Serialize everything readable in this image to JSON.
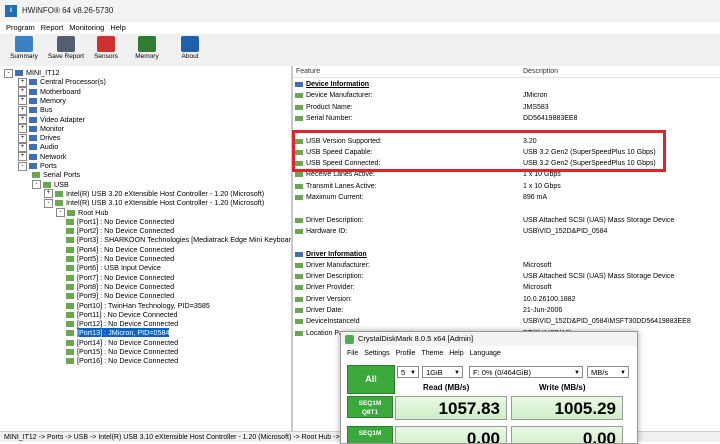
{
  "window": {
    "title": "HWiNFO® 64 v8.26-5730"
  },
  "menu": [
    "Program",
    "Report",
    "Monitoring",
    "Help"
  ],
  "toolbar": [
    {
      "label": "Summary",
      "icon": "summary-icon",
      "color": "#3b82c4"
    },
    {
      "label": "Save Report",
      "icon": "save-icon",
      "color": "#555e6e"
    },
    {
      "label": "Sensors",
      "icon": "thermometer-icon",
      "color": "#d03030"
    },
    {
      "label": "Memory",
      "icon": "memory-icon",
      "color": "#2e7d32"
    },
    {
      "label": "About",
      "icon": "info-icon",
      "color": "#1f5fb0"
    }
  ],
  "tree": [
    {
      "text": "MINI_IT12",
      "level": 0,
      "exp": "-"
    },
    {
      "text": "Central Processor(s)",
      "level": 1,
      "exp": "+"
    },
    {
      "text": "Motherboard",
      "level": 1,
      "exp": "+"
    },
    {
      "text": "Memory",
      "level": 1,
      "exp": "+"
    },
    {
      "text": "Bus",
      "level": 1,
      "exp": "+"
    },
    {
      "text": "Video Adapter",
      "level": 1,
      "exp": "+"
    },
    {
      "text": "Monitor",
      "level": 1,
      "exp": "+"
    },
    {
      "text": "Drives",
      "level": 1,
      "exp": "+"
    },
    {
      "text": "Audio",
      "level": 1,
      "exp": "+"
    },
    {
      "text": "Network",
      "level": 1,
      "exp": "+"
    },
    {
      "text": "Ports",
      "level": 1,
      "exp": "-"
    },
    {
      "text": "Serial Ports",
      "level": 2,
      "exp": ""
    },
    {
      "text": "USB",
      "level": 2,
      "exp": "-"
    },
    {
      "text": "Intel(R) USB 3.20 eXtensible Host Controller - 1.20 (Microsoft)",
      "level": 3,
      "exp": "+"
    },
    {
      "text": "Intel(R) USB 3.10 eXtensible Host Controller - 1.20 (Microsoft)",
      "level": 3,
      "exp": "-"
    },
    {
      "text": "Root Hub",
      "level": 4,
      "exp": "-"
    },
    {
      "text": "[Port1] : No Device Connected",
      "level": 5,
      "exp": ""
    },
    {
      "text": "[Port2] : No Device Connected",
      "level": 5,
      "exp": ""
    },
    {
      "text": "[Port3] : SHARKOON Technologies [Mediatrack Edge Mini Keyboard]",
      "level": 5,
      "exp": ""
    },
    {
      "text": "[Port4] : No Device Connected",
      "level": 5,
      "exp": ""
    },
    {
      "text": "[Port5] : No Device Connected",
      "level": 5,
      "exp": ""
    },
    {
      "text": "[Port6] : USB Input Device",
      "level": 5,
      "exp": ""
    },
    {
      "text": "[Port7] : No Device Connected",
      "level": 5,
      "exp": ""
    },
    {
      "text": "[Port8] : No Device Connected",
      "level": 5,
      "exp": ""
    },
    {
      "text": "[Port9] : No Device Connected",
      "level": 5,
      "exp": ""
    },
    {
      "text": "[Port10] : TwinHan Technology, PID=3585",
      "level": 5,
      "exp": ""
    },
    {
      "text": "[Port11] : No Device Connected",
      "level": 5,
      "exp": ""
    },
    {
      "text": "[Port12] : No Device Connected",
      "level": 5,
      "exp": ""
    },
    {
      "text": "[Port13] : JMicron, PID=0584",
      "level": 5,
      "exp": "",
      "selected": true
    },
    {
      "text": "[Port14] : No Device Connected",
      "level": 5,
      "exp": ""
    },
    {
      "text": "[Port15] : No Device Connected",
      "level": 5,
      "exp": ""
    },
    {
      "text": "[Port16] : No Device Connected",
      "level": 5,
      "exp": ""
    }
  ],
  "details": {
    "columns": {
      "feature": "Feature",
      "description": "Description"
    },
    "rows": [
      {
        "f": "Device Information",
        "v": "",
        "section": true
      },
      {
        "f": "Device Manufacturer:",
        "v": "JMicron"
      },
      {
        "f": "Product Name:",
        "v": "JMS583"
      },
      {
        "f": "Serial Number:",
        "v": "DD56419883EE8"
      },
      {
        "f": "",
        "v": ""
      },
      {
        "f": "USB Version Supported:",
        "v": "3.20"
      },
      {
        "f": "USB Speed Capable:",
        "v": "USB 3.2 Gen2 (SuperSpeedPlus 10 Gbps)"
      },
      {
        "f": "USB Speed Connected:",
        "v": "USB 3.2 Gen2 (SuperSpeedPlus 10 Gbps)"
      },
      {
        "f": "Receive Lanes Active:",
        "v": "1 x 10 Gbps"
      },
      {
        "f": "Transmit Lanes Active:",
        "v": "1 x 10 Gbps"
      },
      {
        "f": "Maximum Current:",
        "v": "896 mA"
      },
      {
        "f": "",
        "v": ""
      },
      {
        "f": "Driver Description:",
        "v": "USB Attached SCSI (UAS) Mass Storage Device"
      },
      {
        "f": "Hardware ID:",
        "v": "USB\\VID_152D&PID_0584"
      },
      {
        "f": "",
        "v": ""
      },
      {
        "f": "Driver Information",
        "v": "",
        "section": true
      },
      {
        "f": "Driver Manufacturer:",
        "v": "Microsoft"
      },
      {
        "f": "Driver Description:",
        "v": "USB Attached SCSI (UAS) Mass Storage Device"
      },
      {
        "f": "Driver Provider:",
        "v": "Microsoft"
      },
      {
        "f": "Driver Version:",
        "v": "10.0.26100.1882"
      },
      {
        "f": "Driver Date:",
        "v": "21-Jun-2006"
      },
      {
        "f": "DeviceInstanceId",
        "v": "USB\\VID_152D&PID_0584\\MSFT30DD56419883EE8"
      },
      {
        "f": "Location Pa",
        "v": "DT(0)#USB(13)"
      }
    ]
  },
  "statusbar": "MINI_IT12 -> Ports -> USB -> Intel(R) USB 3.10 eXtensible Host Controller - 1.20 (Microsoft) -> Root Hub -> ",
  "cdm": {
    "title": "CrystalDiskMark 8.0.5 x64 [Admin]",
    "menu": [
      "File",
      "Settings",
      "Profile",
      "Theme",
      "Help",
      "Language"
    ],
    "all_label": "All",
    "count": "5",
    "size": "1GiB",
    "drive": "F: 0% (0/464GiB)",
    "unit": "MB/s",
    "read_header": "Read (MB/s)",
    "write_header": "Write (MB/s)",
    "tests": [
      {
        "name1": "SEQ1M",
        "name2": "Q8T1",
        "read": "1057.83",
        "write": "1005.29"
      },
      {
        "name1": "SEQ1M",
        "name2": "",
        "read": "0.00",
        "write": "0.00"
      }
    ]
  },
  "colors": {
    "highlight_box": "#e0242a",
    "selection": "#0a64c8",
    "cdm_green": "#3aa83a"
  }
}
